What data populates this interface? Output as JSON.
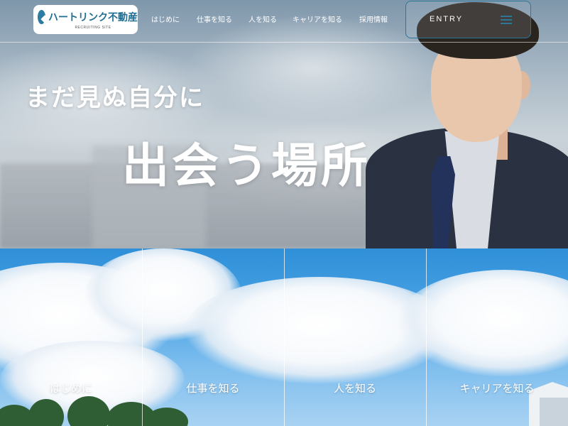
{
  "logo": {
    "name": "ハートリンク不動産",
    "subtitle": "RECRUITING SITE",
    "brand_color": "#1f6d92"
  },
  "nav": {
    "items": [
      {
        "label": "はじめに"
      },
      {
        "label": "仕事を知る"
      },
      {
        "label": "人を知る"
      },
      {
        "label": "キャリアを知る"
      },
      {
        "label": "採用情報"
      }
    ],
    "entry_label": "ENTRY",
    "menu_icon": "hamburger-menu-icon",
    "accent_color": "#2d7698"
  },
  "hero": {
    "catch_line1": "まだ見ぬ自分に",
    "catch_line2": "出会う場所"
  },
  "panels": [
    {
      "label": "はじめに"
    },
    {
      "label": "仕事を知る"
    },
    {
      "label": "人を知る"
    },
    {
      "label": "キャリアを知る"
    }
  ]
}
